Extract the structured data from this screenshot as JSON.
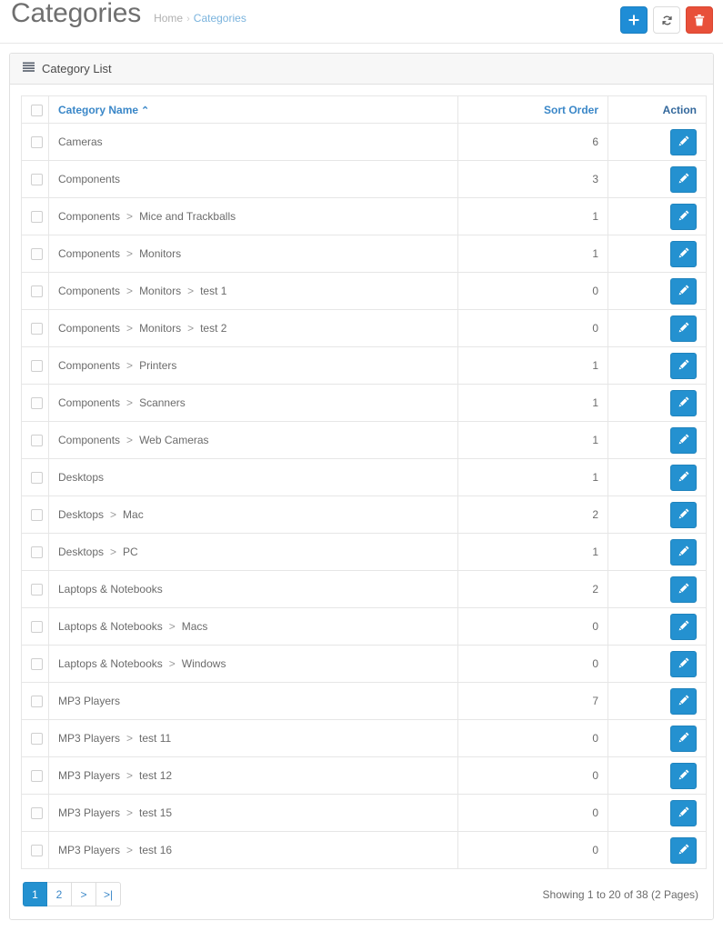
{
  "header": {
    "title": "Categories",
    "breadcrumb": {
      "home": "Home",
      "separator": "›",
      "current": "Categories"
    },
    "actions": [
      {
        "name": "add-new-button",
        "icon": "plus-icon",
        "style": "primary",
        "color": "#1f8dd6"
      },
      {
        "name": "refresh-button",
        "icon": "refresh-icon",
        "style": "default",
        "color": "#ffffff"
      },
      {
        "name": "delete-button",
        "icon": "trash-icon",
        "style": "danger",
        "color": "#e8503a"
      }
    ]
  },
  "panel": {
    "icon": "list-icon",
    "title": "Category List"
  },
  "table": {
    "columns": {
      "select_all": "",
      "name": "Category Name",
      "name_sort_caret": "⌃",
      "sort_order": "Sort Order",
      "action": "Action"
    },
    "edit_icon": "pencil-icon",
    "rows": [
      {
        "name": "Cameras",
        "sort_order": "6"
      },
      {
        "name": "Components",
        "sort_order": "3"
      },
      {
        "name": "Components > Mice and Trackballs",
        "sort_order": "1"
      },
      {
        "name": "Components > Monitors",
        "sort_order": "1"
      },
      {
        "name": "Components > Monitors > test 1",
        "sort_order": "0"
      },
      {
        "name": "Components > Monitors > test 2",
        "sort_order": "0"
      },
      {
        "name": "Components > Printers",
        "sort_order": "1"
      },
      {
        "name": "Components > Scanners",
        "sort_order": "1"
      },
      {
        "name": "Components > Web Cameras",
        "sort_order": "1"
      },
      {
        "name": "Desktops",
        "sort_order": "1"
      },
      {
        "name": "Desktops > Mac",
        "sort_order": "2"
      },
      {
        "name": "Desktops > PC",
        "sort_order": "1"
      },
      {
        "name": "Laptops & Notebooks",
        "sort_order": "2"
      },
      {
        "name": "Laptops & Notebooks > Macs",
        "sort_order": "0"
      },
      {
        "name": "Laptops & Notebooks > Windows",
        "sort_order": "0"
      },
      {
        "name": "MP3 Players",
        "sort_order": "7"
      },
      {
        "name": "MP3 Players > test 11",
        "sort_order": "0"
      },
      {
        "name": "MP3 Players > test 12",
        "sort_order": "0"
      },
      {
        "name": "MP3 Players > test 15",
        "sort_order": "0"
      },
      {
        "name": "MP3 Players > test 16",
        "sort_order": "0"
      }
    ]
  },
  "footer": {
    "pagination": [
      {
        "label": "1",
        "name": "page-1",
        "active": true
      },
      {
        "label": "2",
        "name": "page-2",
        "active": false
      },
      {
        "label": ">",
        "name": "page-next",
        "active": false
      },
      {
        "label": ">|",
        "name": "page-last",
        "active": false
      }
    ],
    "results": "Showing 1 to 20 of 38 (2 Pages)"
  },
  "colors": {
    "primary": "#2491d0",
    "link": "#3a87c8",
    "danger": "#e8503a",
    "text": "#6b6b6b"
  }
}
